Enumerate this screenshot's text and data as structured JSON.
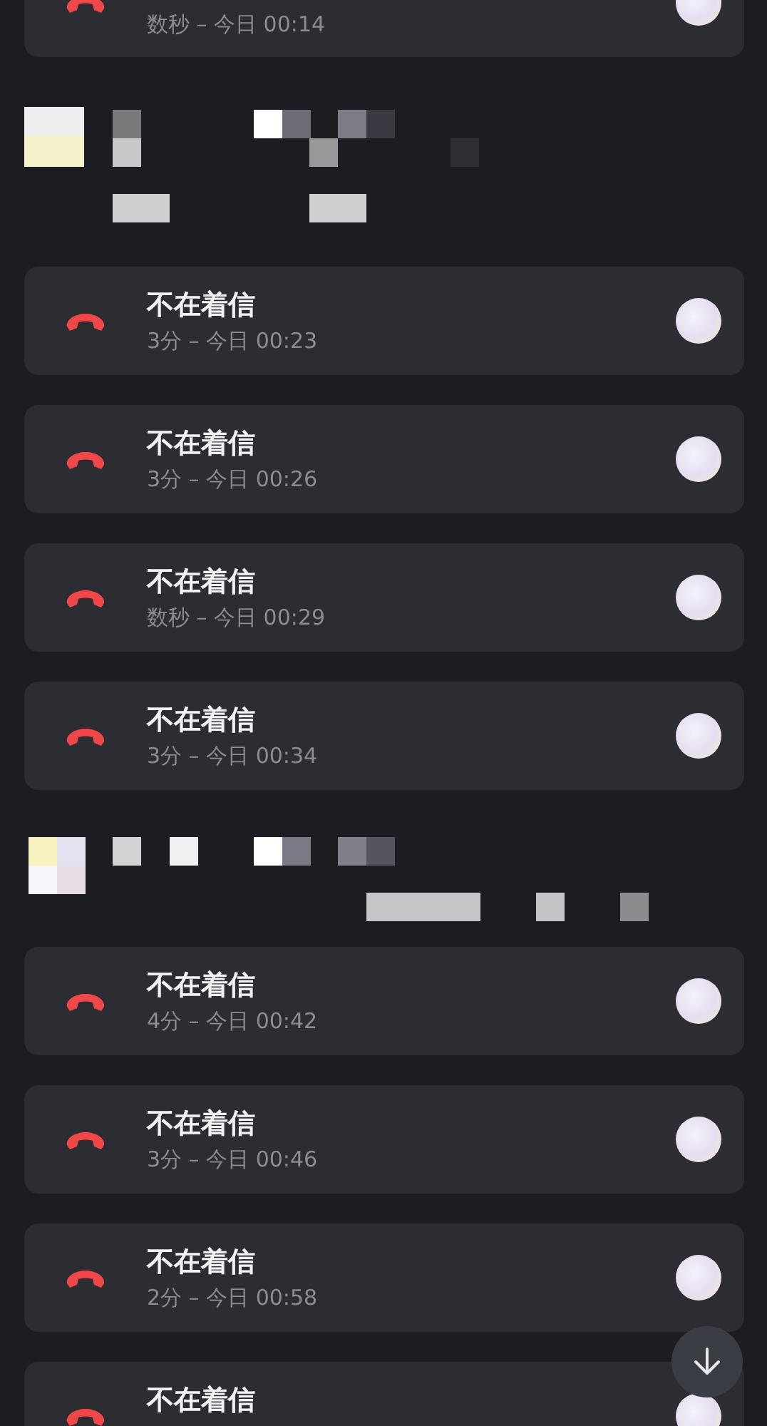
{
  "messages": [
    {
      "kind": "call",
      "subtitle": "数秒 – 今日 00:14"
    },
    {
      "kind": "picture"
    },
    {
      "kind": "call",
      "title": "不在着信",
      "subtitle": "3分 – 今日 00:23"
    },
    {
      "kind": "call",
      "title": "不在着信",
      "subtitle": "3分 – 今日 00:26"
    },
    {
      "kind": "call",
      "title": "不在着信",
      "subtitle": "数秒 – 今日 00:29"
    },
    {
      "kind": "call",
      "title": "不在着信",
      "subtitle": "3分 – 今日 00:34"
    },
    {
      "kind": "picture"
    },
    {
      "kind": "call",
      "title": "不在着信",
      "subtitle": "4分 – 今日 00:42"
    },
    {
      "kind": "call",
      "title": "不在着信",
      "subtitle": "3分 – 今日 00:46"
    },
    {
      "kind": "call",
      "title": "不在着信",
      "subtitle": "2分 – 今日 00:58"
    },
    {
      "kind": "call",
      "title": "不在着信"
    }
  ]
}
